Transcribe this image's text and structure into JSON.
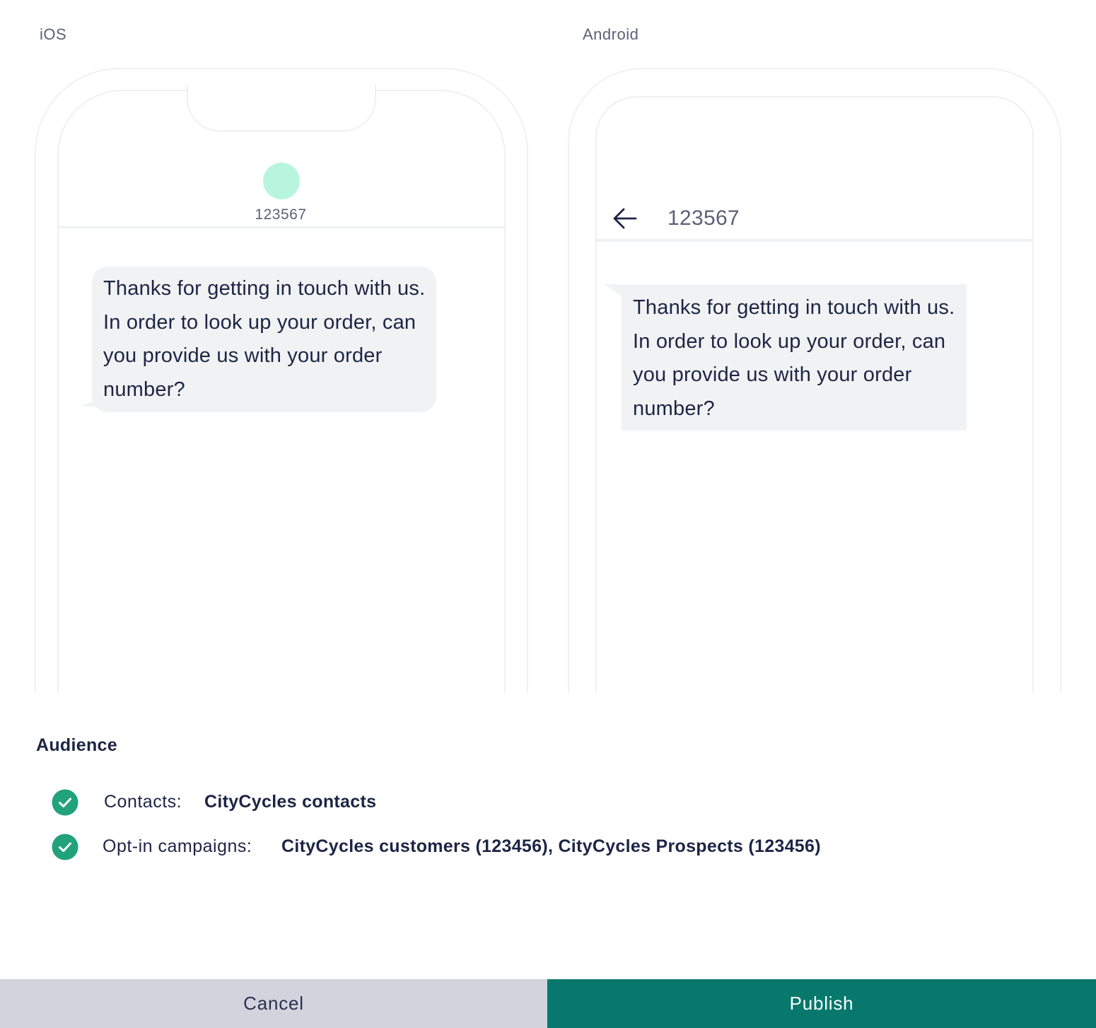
{
  "preview": {
    "ios": {
      "platform_label": "iOS",
      "contact_name": "123567",
      "avatar_color": "#b8f5df",
      "message": "Thanks for getting in touch with us. In order to look up your order, can you provide us with your order number?"
    },
    "android": {
      "platform_label": "Android",
      "contact_name": "123567",
      "back_icon": "arrow-left-icon",
      "message": "Thanks for getting in touch with us. In order to look up your order, can you provide us with your order number?"
    }
  },
  "audience": {
    "title": "Audience",
    "items": [
      {
        "icon": "check-circle-icon",
        "label": "Contacts:",
        "value": "CityCycles contacts"
      },
      {
        "icon": "check-circle-icon",
        "label": "Opt-in campaigns:",
        "value": "CityCycles customers (123456), CityCycles Prospects (123456)"
      }
    ],
    "check_color": "#21a27a"
  },
  "footer": {
    "cancel_label": "Cancel",
    "publish_label": "Publish",
    "publish_color": "#08786c",
    "cancel_color": "#d2d4dd"
  }
}
